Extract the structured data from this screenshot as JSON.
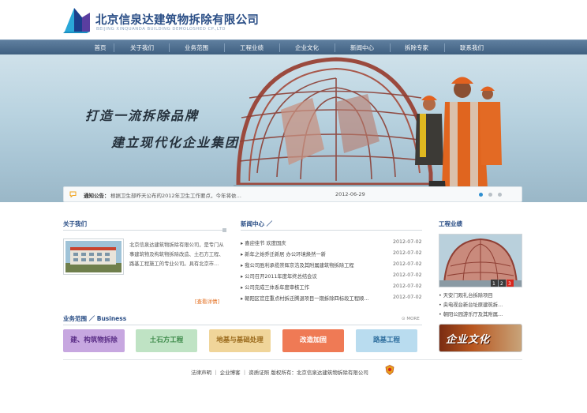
{
  "company": {
    "name_cn": "北京信泉达建筑物拆除有限公司",
    "name_en": "BEIJING XINQUANDA BUILDING DEMOLOSHED CP.,LTD"
  },
  "nav": [
    "首页",
    "关于我们",
    "业务范围",
    "工程业绩",
    "企业文化",
    "新闻中心",
    "拆除专家",
    "联系我们"
  ],
  "banner": {
    "slogan1": "打造一流拆除品牌",
    "slogan2": "建立现代化企业集团"
  },
  "notice": {
    "label": "通知公告：",
    "text": "根据卫生部昨天公布的2012年卫生工作要点，今年将依…",
    "date": "2012-06-29"
  },
  "about": {
    "title": "关于我们",
    "text": "北京信泉达建筑物拆除有限公司，是专门从事建筑物及构筑物拆除改造、土石方工程、路基工程施工的专业公司。具有北京市…",
    "more": "[查看详情]"
  },
  "news": {
    "title": "新闻中心 ／",
    "items": [
      {
        "title": "喜迎佳节  欢度国庆",
        "date": "2012-07-02"
      },
      {
        "title": "新年之始乔迁新居  办公环境焕然一新",
        "date": "2012-07-02"
      },
      {
        "title": "我公司胜利承揽崇辉京浩及其附属建筑物拆除工程",
        "date": "2012-07-02"
      },
      {
        "title": "公司召开2011年度年终总结会议",
        "date": "2012-07-02"
      },
      {
        "title": "公司完成三体系年度审核工作",
        "date": "2012-07-02"
      },
      {
        "title": "朝阳区官庄重点村拆迁腾退项目一期拆除四标段工程顺…",
        "date": "2012-07-02"
      }
    ]
  },
  "projects": {
    "title": "工程业绩",
    "pager": [
      "1",
      "2",
      "3"
    ],
    "items": [
      "天安门观礼台拆除项目",
      "央电视台新台址原建筑拆…",
      "朝阳公园游乐厅及其附属…"
    ]
  },
  "culture": {
    "label": "企业文化"
  },
  "business": {
    "title": "业务范围 ／ Business",
    "more": "MORE",
    "items": [
      {
        "label": "建、构筑物拆除",
        "bg": "#c7a7e0",
        "fg": "#5a2d86"
      },
      {
        "label": "土石方工程",
        "bg": "#bfe3c4",
        "fg": "#3d8a4a"
      },
      {
        "label": "地基与基础处理",
        "bg": "#f0d59a",
        "fg": "#9a6a1c"
      },
      {
        "label": "改造加固",
        "bg": "#ef7a55",
        "fg": "#ffffff"
      },
      {
        "label": "路基工程",
        "bg": "#b9dcef",
        "fg": "#2f6f9e"
      }
    ]
  },
  "footer": {
    "text": "法律声明  ｜  企业博客  ｜  资质证照  版权所有：北京信泉达建筑物拆除有限公司"
  },
  "colors": {
    "brand": "#2a4e86",
    "nav": "#4b6b8c",
    "accent": "#e36b1a"
  }
}
